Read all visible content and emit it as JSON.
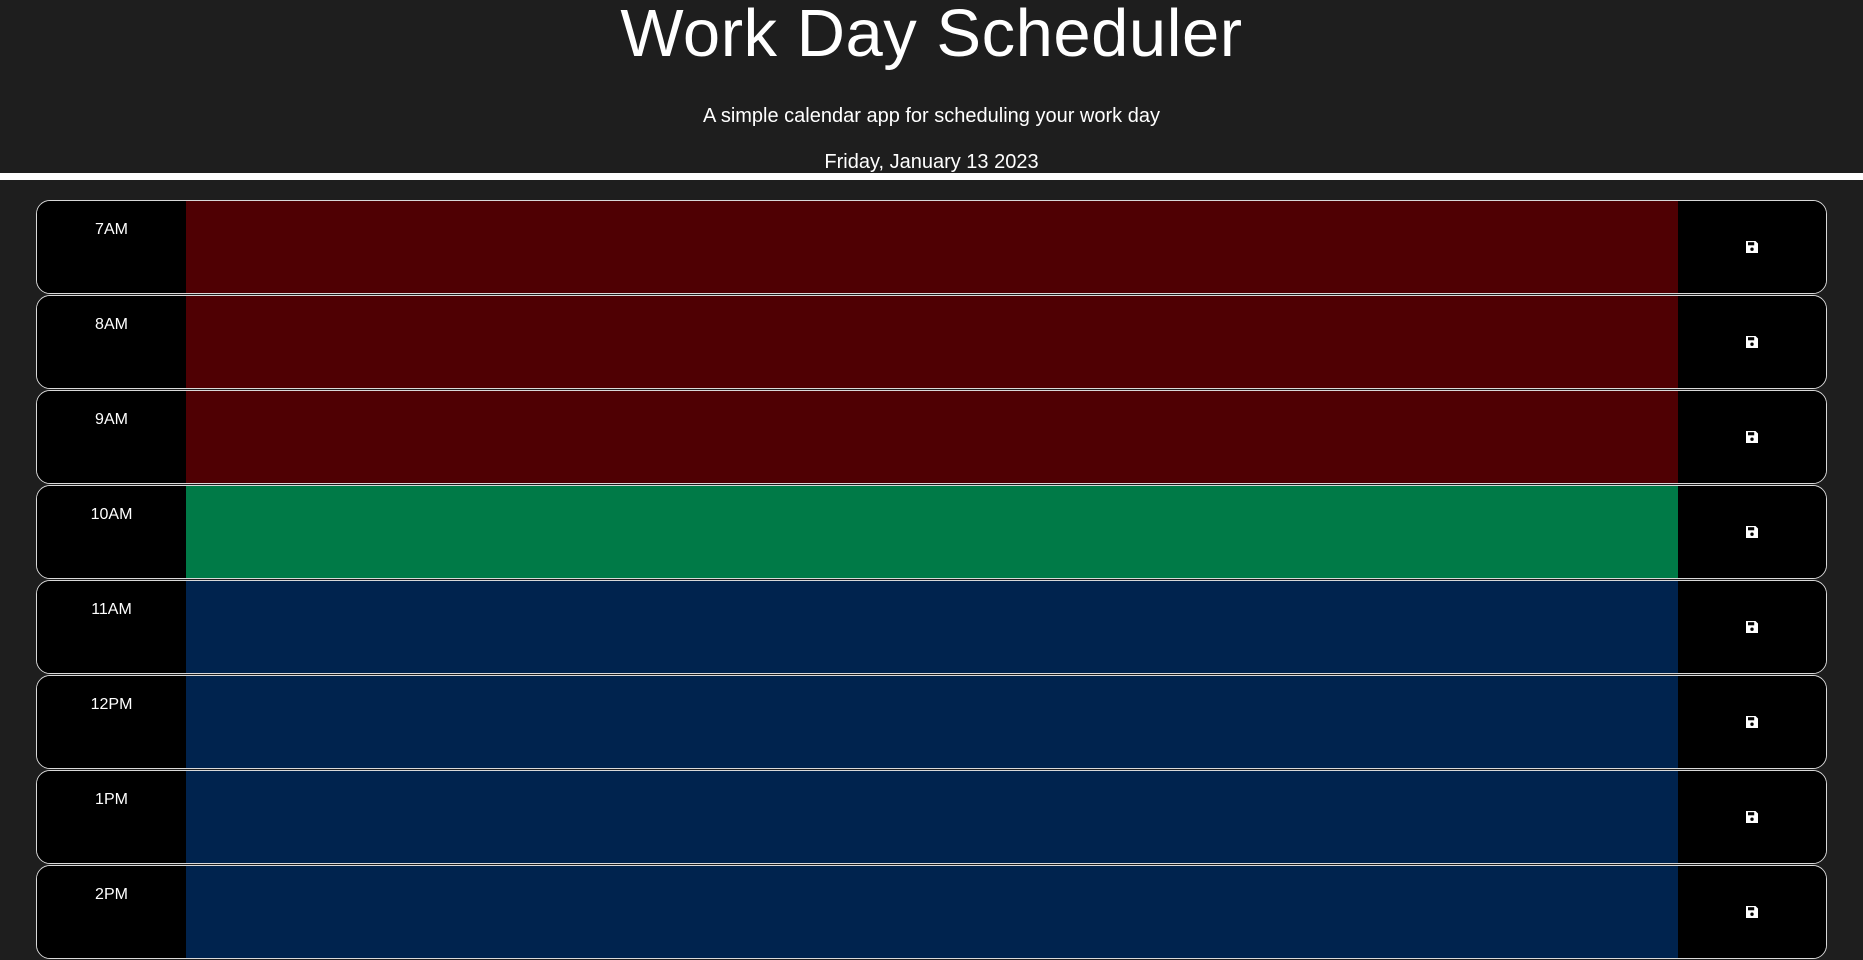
{
  "header": {
    "title": "Work Day Scheduler",
    "lead": "A simple calendar app for scheduling your work day",
    "current_day": "Friday, January 13 2023"
  },
  "colors": {
    "past": "#4f0003",
    "present": "#007a47",
    "future": "#00234e",
    "background": "#1e1e1e"
  },
  "rows": [
    {
      "hour": "7AM",
      "state": "past",
      "text": "",
      "save_icon": "save-icon"
    },
    {
      "hour": "8AM",
      "state": "past",
      "text": "",
      "save_icon": "save-icon"
    },
    {
      "hour": "9AM",
      "state": "past",
      "text": "",
      "save_icon": "save-icon"
    },
    {
      "hour": "10AM",
      "state": "present",
      "text": "",
      "save_icon": "save-icon"
    },
    {
      "hour": "11AM",
      "state": "future",
      "text": "",
      "save_icon": "save-icon"
    },
    {
      "hour": "12PM",
      "state": "future",
      "text": "",
      "save_icon": "save-icon"
    },
    {
      "hour": "1PM",
      "state": "future",
      "text": "",
      "save_icon": "save-icon"
    },
    {
      "hour": "2PM",
      "state": "future",
      "text": "",
      "save_icon": "save-icon"
    }
  ]
}
